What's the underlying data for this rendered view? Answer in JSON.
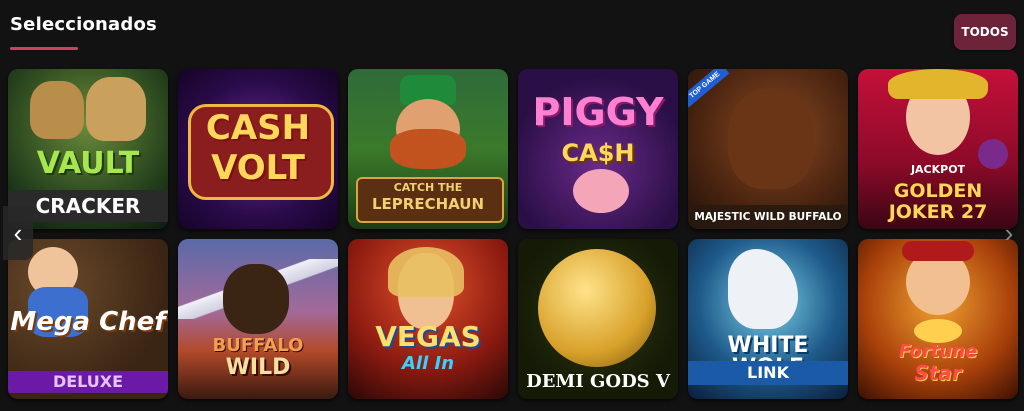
{
  "section": {
    "title": "Seleccionados",
    "all_button": "TODOS"
  },
  "accent_color": "#c9435f",
  "games": [
    {
      "title": "VAULT",
      "subtitle": "CRACKER"
    },
    {
      "title": "CASH",
      "subtitle": "VOLT"
    },
    {
      "title": "CATCH THE",
      "subtitle": "LEPRECHAUN"
    },
    {
      "title": "PIGGY",
      "subtitle": "CA$H"
    },
    {
      "title": "",
      "subtitle": "MAJESTIC WILD BUFFALO",
      "badge": "TOP GAME"
    },
    {
      "title": "JACKPOT",
      "subtitle": "GOLDEN JOKER 27"
    },
    {
      "title": "Mega Chef",
      "subtitle": "DELUXE"
    },
    {
      "title": "BUFFALO",
      "subtitle": "WILD"
    },
    {
      "title": "VEGAS",
      "subtitle": "All In"
    },
    {
      "title": "",
      "subtitle": "DEMI GODS V"
    },
    {
      "title": "WHITE WOLF",
      "subtitle": "LINK"
    },
    {
      "title": "Fortune",
      "subtitle": "Star"
    }
  ],
  "nav": {
    "prev_icon": "chevron-left-icon",
    "next_icon": "chevron-right-icon"
  }
}
